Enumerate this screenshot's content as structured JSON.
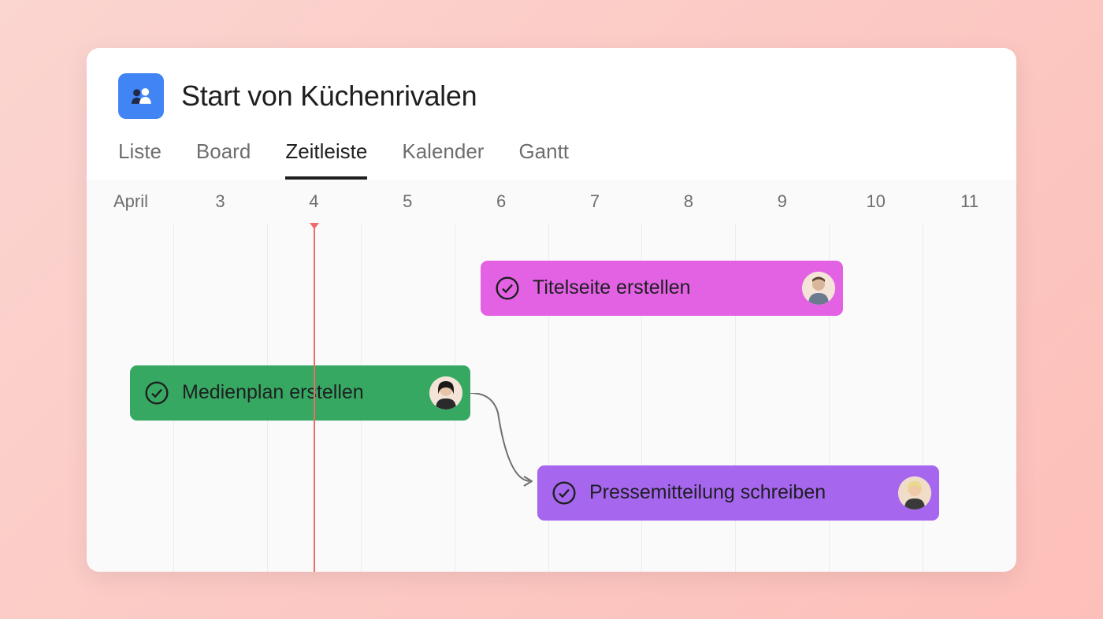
{
  "project": {
    "title": "Start von Küchenrivalen",
    "icon_color": "#4185f4"
  },
  "tabs": [
    {
      "label": "Liste",
      "active": false
    },
    {
      "label": "Board",
      "active": false
    },
    {
      "label": "Zeitleiste",
      "active": true
    },
    {
      "label": "Kalender",
      "active": false
    },
    {
      "label": "Gantt",
      "active": false
    }
  ],
  "timeline": {
    "month": "April",
    "dates": [
      "3",
      "4",
      "5",
      "6",
      "7",
      "8",
      "9",
      "10",
      "11"
    ],
    "current_marker_date": "4",
    "marker_color": "#f06a6a"
  },
  "tasks": [
    {
      "id": "titelseite",
      "label": "Titelseite erstellen",
      "color": "#e362e3",
      "start_date": "6",
      "end_date": "9.5",
      "row": 0
    },
    {
      "id": "medienplan",
      "label": "Medienplan erstellen",
      "color": "#37a862",
      "start_date": "3",
      "end_date": "6",
      "row": 1
    },
    {
      "id": "pressemitteilung",
      "label": "Pressemitteilung schreiben",
      "color": "#a666ee",
      "start_date": "6.5",
      "end_date": "10.5",
      "row": 2
    }
  ]
}
